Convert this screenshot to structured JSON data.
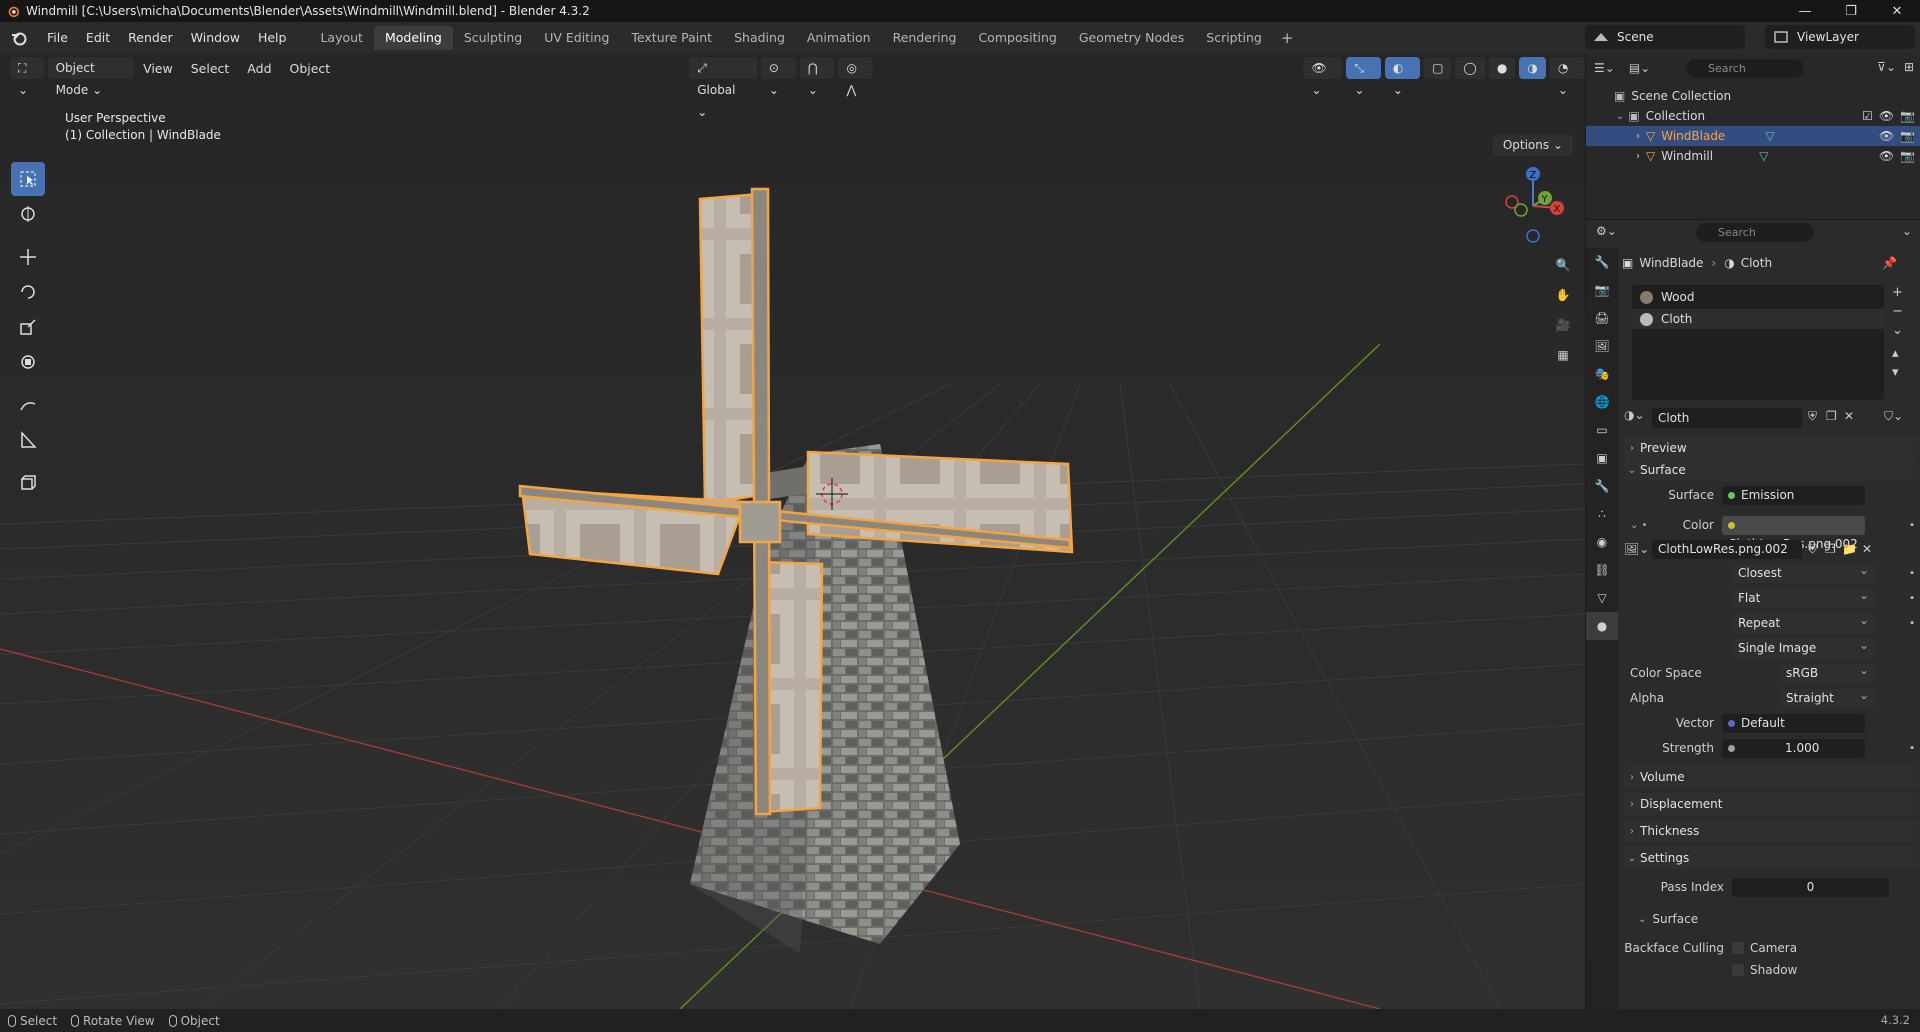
{
  "window": {
    "title": "Windmill [C:\\Users\\micha\\Documents\\Blender\\Assets\\Windmill\\Windmill.blend] - Blender 4.3.2"
  },
  "menu": [
    "File",
    "Edit",
    "Render",
    "Window",
    "Help"
  ],
  "workspaces": [
    "Layout",
    "Modeling",
    "Sculpting",
    "UV Editing",
    "Texture Paint",
    "Shading",
    "Animation",
    "Rendering",
    "Compositing",
    "Geometry Nodes",
    "Scripting"
  ],
  "active_workspace": "Modeling",
  "scene": "Scene",
  "view_layer": "ViewLayer",
  "viewport": {
    "mode": "Object Mode",
    "menus": [
      "View",
      "Select",
      "Add",
      "Object"
    ],
    "transform_orientation": "Global",
    "options_label": "Options",
    "info_line1": "User Perspective",
    "info_line2": "(1) Collection | WindBlade",
    "gizmo": {
      "z": "Z",
      "y": "Y",
      "x": "X"
    }
  },
  "outliner": {
    "search_placeholder": "Search",
    "scene_collection": "Scene Collection",
    "collection": "Collection",
    "objects": [
      {
        "name": "WindBlade",
        "selected": true
      },
      {
        "name": "Windmill",
        "selected": false
      }
    ]
  },
  "properties": {
    "search_placeholder": "Search",
    "breadcrumb_object": "WindBlade",
    "breadcrumb_material": "Cloth",
    "slots": [
      "Wood",
      "Cloth"
    ],
    "material_name": "Cloth",
    "panels": {
      "preview": "Preview",
      "surface": "Surface",
      "volume": "Volume",
      "displacement": "Displacement",
      "thickness": "Thickness",
      "settings": "Settings",
      "settings_surface": "Surface"
    },
    "surface_label": "Surface",
    "surface_value": "Emission",
    "color_label": "Color",
    "color_value": "ClothLowRes.png.002",
    "image_name": "ClothLowRes.png.002",
    "interpolation": "Closest",
    "projection": "Flat",
    "extension": "Repeat",
    "source": "Single Image",
    "color_space_label": "Color Space",
    "color_space": "sRGB",
    "alpha_label": "Alpha",
    "alpha": "Straight",
    "vector_label": "Vector",
    "vector": "Default",
    "strength_label": "Strength",
    "strength": "1.000",
    "pass_index_label": "Pass Index",
    "pass_index": "0",
    "backface_label": "Backface Culling",
    "camera": "Camera",
    "shadow": "Shadow"
  },
  "statusbar": {
    "select": "Select",
    "rotate": "Rotate View",
    "object": "Object",
    "version": "4.3.2"
  },
  "colors": {
    "selection_orange": "#f5a442",
    "active_blue": "#4772b3",
    "outliner_selected": "#334d80"
  }
}
